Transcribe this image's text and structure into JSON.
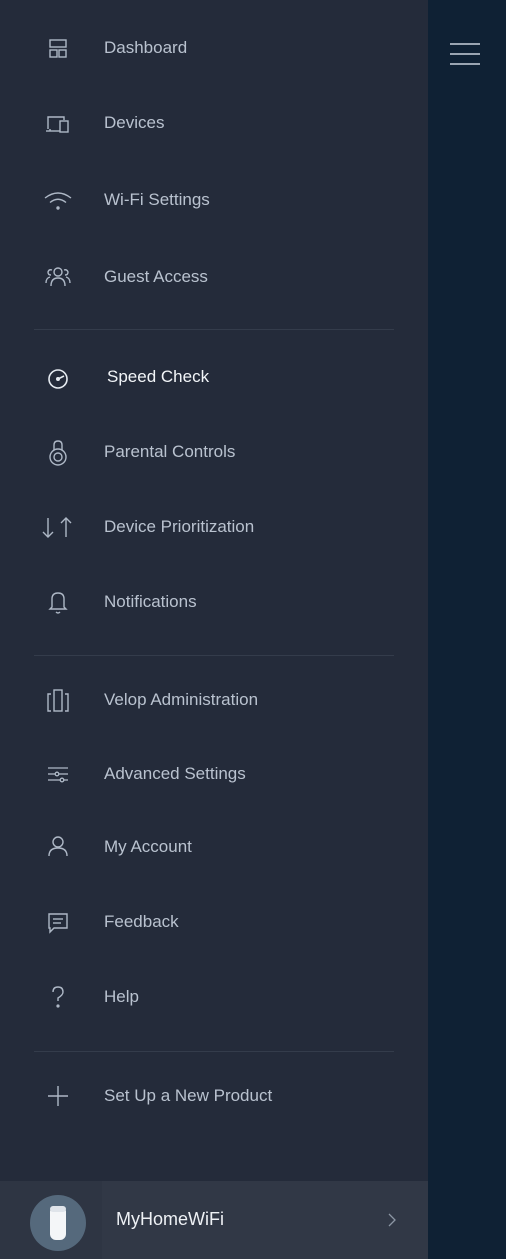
{
  "menu": {
    "items": [
      {
        "label": "Dashboard",
        "icon": "dashboard-icon"
      },
      {
        "label": "Devices",
        "icon": "devices-icon"
      },
      {
        "label": "Wi-Fi Settings",
        "icon": "wifi-icon"
      },
      {
        "label": "Guest Access",
        "icon": "guest-icon"
      },
      {
        "label": "Speed Check",
        "icon": "speedometer-icon",
        "active": true
      },
      {
        "label": "Parental Controls",
        "icon": "parental-lock-icon"
      },
      {
        "label": "Device Prioritization",
        "icon": "priority-arrows-icon"
      },
      {
        "label": "Notifications",
        "icon": "bell-icon"
      },
      {
        "label": "Velop Administration",
        "icon": "velop-nodes-icon"
      },
      {
        "label": "Advanced Settings",
        "icon": "sliders-icon"
      },
      {
        "label": "My Account",
        "icon": "user-icon"
      },
      {
        "label": "Feedback",
        "icon": "chat-bubble-icon"
      },
      {
        "label": "Help",
        "icon": "question-icon"
      },
      {
        "label": "Set Up a New Product",
        "icon": "plus-icon"
      }
    ]
  },
  "network": {
    "name": "MyHomeWiFi",
    "icon": "velop-node-icon"
  },
  "header": {
    "menu_icon": "hamburger-menu-icon"
  },
  "colors": {
    "drawer_bg": "#242b3a",
    "backdrop_bg": "#0f2134",
    "label": "#b9c2cf",
    "label_active": "#f2f5f8",
    "icon": "#aeb8c6"
  }
}
